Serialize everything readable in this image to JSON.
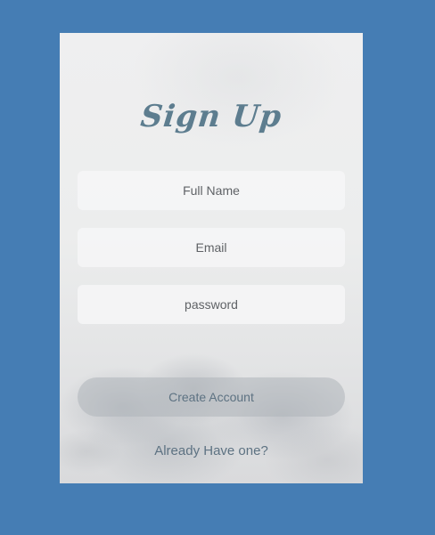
{
  "colors": {
    "page_background": "#457db4",
    "title": "#5d7d8f",
    "button_text": "#5d7282"
  },
  "form": {
    "title": "Sign Up",
    "fullname_placeholder": "Full Name",
    "email_placeholder": "Email",
    "password_placeholder": "password",
    "submit_label": "Create Account",
    "login_link": "Already Have one?"
  }
}
